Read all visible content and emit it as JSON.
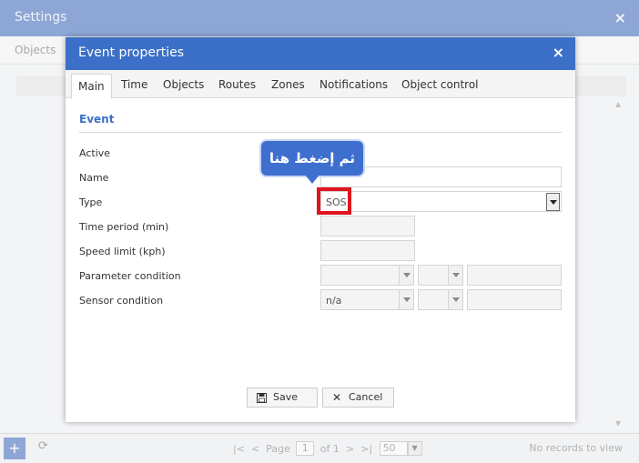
{
  "background": {
    "title": "Settings",
    "close_icon": "×",
    "tab": "Objects",
    "footer": {
      "add_icon": "+",
      "refresh_icon": "⟳",
      "first_icon": "|<",
      "prev_icon": "<",
      "page_label": "Page",
      "page_value": "1",
      "of_label": "of 1",
      "next_icon": ">",
      "last_icon": ">|",
      "page_size": "50",
      "no_records": "No records to view"
    }
  },
  "dialog": {
    "title": "Event properties",
    "close_icon": "×",
    "tabs": [
      "Main",
      "Time",
      "Objects",
      "Routes",
      "Zones",
      "Notifications",
      "Object control"
    ],
    "section": "Event",
    "labels": {
      "active": "Active",
      "name": "Name",
      "type": "Type",
      "time_period": "Time period (min)",
      "speed_limit": "Speed limit (kph)",
      "parameter_condition": "Parameter condition",
      "sensor_condition": "Sensor condition"
    },
    "fields": {
      "name_value": "",
      "type_value": "SOS",
      "time_period_value": "",
      "speed_limit_value": "",
      "sensor_value": "n/a"
    },
    "callout": "ثم إضغط هنا",
    "buttons": {
      "save": "Save",
      "save_icon": "💾",
      "cancel": "Cancel",
      "cancel_icon": "✕"
    }
  },
  "colors": {
    "dialog_header": "#3c70c8",
    "highlight": "#e0141f",
    "callout": "#3e6fcf"
  }
}
